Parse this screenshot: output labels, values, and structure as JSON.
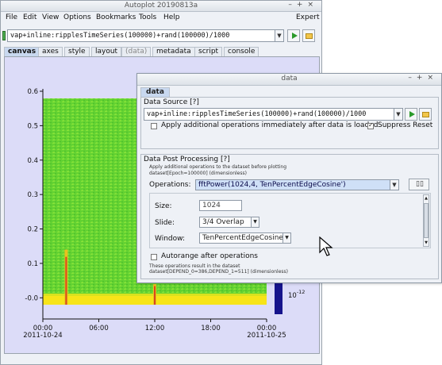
{
  "main_window": {
    "title": "Autoplot 20190813a",
    "controls": [
      "–",
      "+",
      "×"
    ],
    "menu": [
      "File",
      "Edit",
      "View",
      "Options",
      "Bookmarks",
      "Tools",
      "Help"
    ],
    "menu_right": "Expert",
    "uri": "vap+inline:ripplesTimeSeries(100000)+rand(100000)/1000",
    "tabs": [
      "canvas",
      "axes",
      "style",
      "layout",
      "(data)",
      "metadata",
      "script",
      "console"
    ],
    "selected_tab": "canvas"
  },
  "chart_data": {
    "type": "heatmap",
    "y_ticks": [
      "0.6",
      "0.5",
      "0.4",
      "0.3",
      "0.2",
      "0.1",
      "-0.0"
    ],
    "ylim": [
      -0.02,
      0.6
    ],
    "x_ticks": [
      {
        "time": "00:00",
        "date": "2011-10-24"
      },
      {
        "time": "06:00",
        "date": ""
      },
      {
        "time": "12:00",
        "date": ""
      },
      {
        "time": "18:00",
        "date": ""
      },
      {
        "time": "00:00",
        "date": "2011-10-25"
      }
    ],
    "colorbar_label": "10",
    "colorbar_exponent": "-12",
    "colors": {
      "background": "#5fcf2e",
      "low_band": "#f7e418",
      "spike": "#d9481c",
      "colorbar": "#16148c"
    },
    "spikes_hours": [
      2.5,
      12
    ]
  },
  "dialog": {
    "title": "data",
    "controls": [
      "–",
      "+",
      "×"
    ],
    "tab": "data",
    "data_source": {
      "header": "Data Source [?]",
      "uri": "vap+inline:ripplesTimeSeries(100000)+rand(100000)/1000",
      "apply_label": "Apply additional operations immediately after data is loaded",
      "apply_checked": false,
      "suppress_label": "Suppress Reset",
      "suppress_checked": true
    },
    "post": {
      "header": "Data Post Processing [?]",
      "apply_note": "Apply additional operations to the dataset before plotting",
      "dataset_in": "dataset[Epoch=100000] (dimensionless)",
      "operations_label": "Operations:",
      "operations_value": "fftPower(1024,4, TenPercentEdgeCosine')",
      "size_label": "Size:",
      "size_value": "1024",
      "slide_label": "Slide:",
      "slide_value": "3/4 Overlap",
      "window_label": "Window:",
      "window_value": "TenPercentEdgeCosine",
      "autorange_label": "Autorange after operations",
      "autorange_checked": false,
      "result_note": "These operations result in the dataset",
      "dataset_out": "dataset[DEPEND_0=386,DEPEND_1=511] (dimensionless)"
    }
  }
}
